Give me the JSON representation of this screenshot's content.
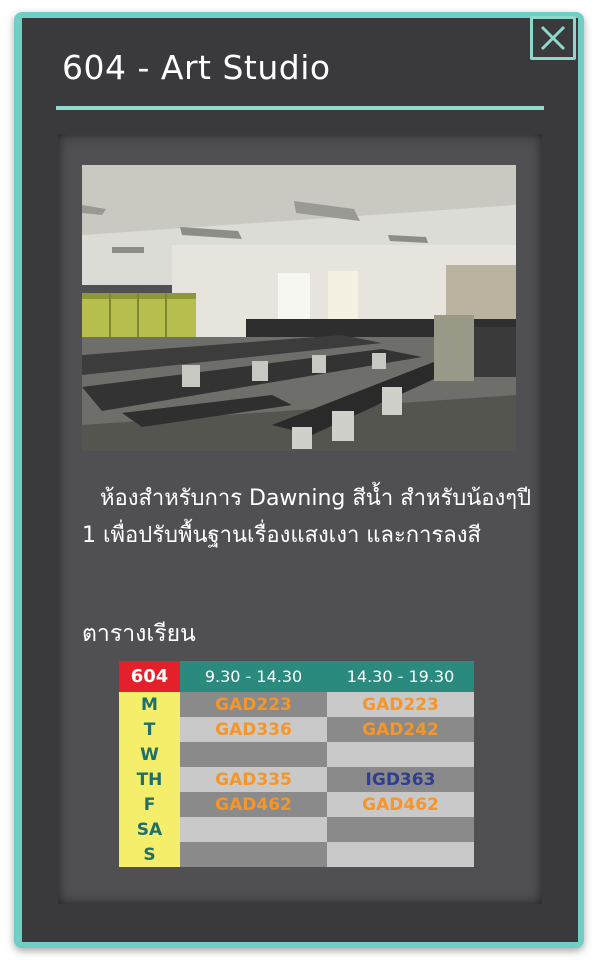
{
  "window": {
    "title": "604 - Art Studio",
    "close_icon": "close-icon"
  },
  "room": {
    "photo": "classroom-photo",
    "description": "ห้องสำหรับการ Dawning สีน้ำ สำหรับน้องๆปี 1 เพื่อปรับพื้นฐานเรื่องแสงเงา และการลงสี"
  },
  "schedule": {
    "heading": "ตารางเรียน",
    "room_label": "604",
    "slot_headers": [
      "9.30 - 14.30",
      "14.30 - 19.30"
    ],
    "rows": [
      {
        "day": "M",
        "slot1": "GAD223",
        "slot2": "GAD223"
      },
      {
        "day": "T",
        "slot1": "GAD336",
        "slot2": "GAD242"
      },
      {
        "day": "W",
        "slot1": "",
        "slot2": ""
      },
      {
        "day": "TH",
        "slot1": "GAD335",
        "slot2": "IGD363"
      },
      {
        "day": "F",
        "slot1": "GAD462",
        "slot2": "GAD462"
      },
      {
        "day": "SA",
        "slot1": "",
        "slot2": ""
      },
      {
        "day": "S",
        "slot1": "",
        "slot2": ""
      }
    ]
  },
  "colors": {
    "frame": "#6fcfc4",
    "card": "#3a3a3c",
    "accent": "#92d8cf",
    "room_badge": "#e4212b",
    "header_teal": "#2a8a7e",
    "day_yellow": "#f5ee6a",
    "course_orange": "#f4962a",
    "course_blue": "#2e3e94"
  }
}
